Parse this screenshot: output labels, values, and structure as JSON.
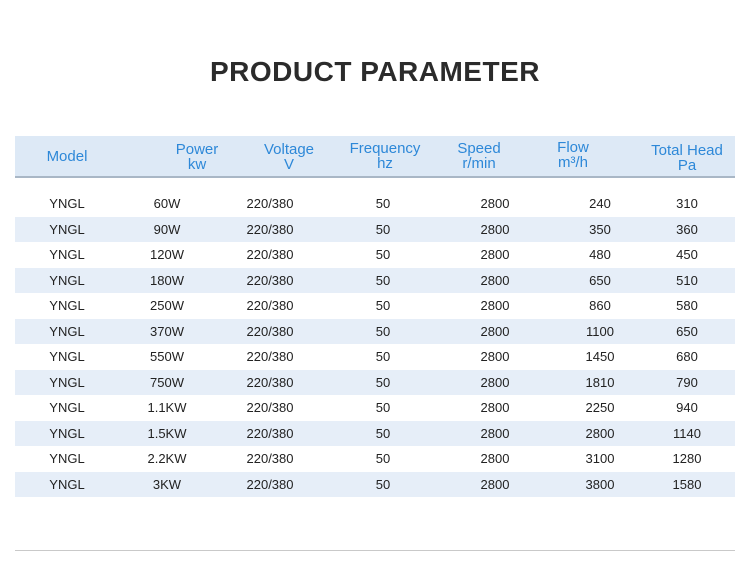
{
  "title": "PRODUCT PARAMETER",
  "header": {
    "model": [
      "Model"
    ],
    "power": [
      "Power",
      "kw"
    ],
    "voltage": [
      "Voltage",
      "V"
    ],
    "frequency": [
      "Frequency",
      "hz"
    ],
    "speed": [
      "Speed",
      "r/min"
    ],
    "flow": [
      "Flow",
      "m³/h"
    ],
    "head": [
      "Total Head",
      "Pa"
    ]
  },
  "rows": [
    [
      "YNGL",
      "60W",
      "220/380",
      "50",
      "2800",
      "240",
      "310"
    ],
    [
      "YNGL",
      "90W",
      "220/380",
      "50",
      "2800",
      "350",
      "360"
    ],
    [
      "YNGL",
      "120W",
      "220/380",
      "50",
      "2800",
      "480",
      "450"
    ],
    [
      "YNGL",
      "180W",
      "220/380",
      "50",
      "2800",
      "650",
      "510"
    ],
    [
      "YNGL",
      "250W",
      "220/380",
      "50",
      "2800",
      "860",
      "580"
    ],
    [
      "YNGL",
      "370W",
      "220/380",
      "50",
      "2800",
      "1100",
      "650"
    ],
    [
      "YNGL",
      "550W",
      "220/380",
      "50",
      "2800",
      "1450",
      "680"
    ],
    [
      "YNGL",
      "750W",
      "220/380",
      "50",
      "2800",
      "1810",
      "790"
    ],
    [
      "YNGL",
      "1.1KW",
      "220/380",
      "50",
      "2800",
      "2250",
      "940"
    ],
    [
      "YNGL",
      "1.5KW",
      "220/380",
      "50",
      "2800",
      "2800",
      "1140"
    ],
    [
      "YNGL",
      "2.2KW",
      "220/380",
      "50",
      "2800",
      "3100",
      "1280"
    ],
    [
      "YNGL",
      "3KW",
      "220/380",
      "50",
      "2800",
      "3800",
      "1580"
    ]
  ],
  "colors": {
    "header_bg": "#dde9f6",
    "header_text": "#2d88d8",
    "alt_row": "#e6eef8"
  }
}
